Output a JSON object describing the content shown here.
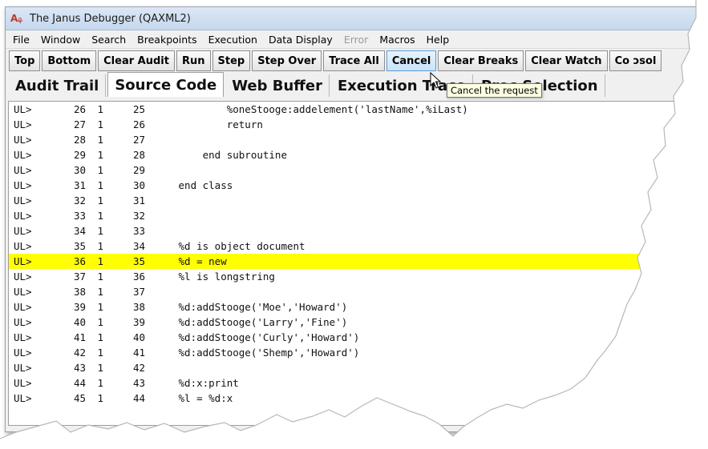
{
  "window": {
    "title": "The Janus Debugger (QAXML2)"
  },
  "menu": [
    {
      "label": "File",
      "disabled": false
    },
    {
      "label": "Window",
      "disabled": false
    },
    {
      "label": "Search",
      "disabled": false
    },
    {
      "label": "Breakpoints",
      "disabled": false
    },
    {
      "label": "Execution",
      "disabled": false
    },
    {
      "label": "Data Display",
      "disabled": false
    },
    {
      "label": "Error",
      "disabled": true
    },
    {
      "label": "Macros",
      "disabled": false
    },
    {
      "label": "Help",
      "disabled": false
    }
  ],
  "toolbar": [
    {
      "label": "Top",
      "active": false
    },
    {
      "label": "Bottom",
      "active": false
    },
    {
      "label": "Clear Audit",
      "active": false
    },
    {
      "label": "Run",
      "active": false
    },
    {
      "label": "Step",
      "active": false
    },
    {
      "label": "Step Over",
      "active": false
    },
    {
      "label": "Trace All",
      "active": false
    },
    {
      "label": "Cancel",
      "active": true
    },
    {
      "label": "Clear Breaks",
      "active": false
    },
    {
      "label": "Clear Watch",
      "active": false
    },
    {
      "label": "Co ɔsol",
      "active": false
    }
  ],
  "tabs": [
    {
      "label": "Audit Trail",
      "selected": false
    },
    {
      "label": "Source Code",
      "selected": true
    },
    {
      "label": "Web Buffer",
      "selected": false
    },
    {
      "label": "Execution Trace",
      "selected": false
    },
    {
      "label": "Proc Selection",
      "selected": false
    }
  ],
  "tooltip": "Cancel the request",
  "highlight_color": "#ffff00",
  "code_lines": [
    {
      "prefix": "UL>",
      "num": "26",
      "lvl": "1",
      "src": "25",
      "text": "         %oneStooge:addelement('lastName',%iLast)",
      "highlight": false
    },
    {
      "prefix": "UL>",
      "num": "27",
      "lvl": "1",
      "src": "26",
      "text": "         return",
      "highlight": false
    },
    {
      "prefix": "UL>",
      "num": "28",
      "lvl": "1",
      "src": "27",
      "text": "",
      "highlight": false
    },
    {
      "prefix": "UL>",
      "num": "29",
      "lvl": "1",
      "src": "28",
      "text": "     end subroutine",
      "highlight": false
    },
    {
      "prefix": "UL>",
      "num": "30",
      "lvl": "1",
      "src": "29",
      "text": "",
      "highlight": false
    },
    {
      "prefix": "UL>",
      "num": "31",
      "lvl": "1",
      "src": "30",
      "text": " end class",
      "highlight": false
    },
    {
      "prefix": "UL>",
      "num": "32",
      "lvl": "1",
      "src": "31",
      "text": "",
      "highlight": false
    },
    {
      "prefix": "UL>",
      "num": "33",
      "lvl": "1",
      "src": "32",
      "text": "",
      "highlight": false
    },
    {
      "prefix": "UL>",
      "num": "34",
      "lvl": "1",
      "src": "33",
      "text": "",
      "highlight": false
    },
    {
      "prefix": "UL>",
      "num": "35",
      "lvl": "1",
      "src": "34",
      "text": " %d is object document",
      "highlight": false
    },
    {
      "prefix": "UL>",
      "num": "36",
      "lvl": "1",
      "src": "35",
      "text": " %d = new",
      "highlight": true
    },
    {
      "prefix": "UL>",
      "num": "37",
      "lvl": "1",
      "src": "36",
      "text": " %l is longstring",
      "highlight": false
    },
    {
      "prefix": "UL>",
      "num": "38",
      "lvl": "1",
      "src": "37",
      "text": "",
      "highlight": false
    },
    {
      "prefix": "UL>",
      "num": "39",
      "lvl": "1",
      "src": "38",
      "text": " %d:addStooge('Moe','Howard')",
      "highlight": false
    },
    {
      "prefix": "UL>",
      "num": "40",
      "lvl": "1",
      "src": "39",
      "text": " %d:addStooge('Larry','Fine')",
      "highlight": false
    },
    {
      "prefix": "UL>",
      "num": "41",
      "lvl": "1",
      "src": "40",
      "text": " %d:addStooge('Curly','Howard')",
      "highlight": false
    },
    {
      "prefix": "UL>",
      "num": "42",
      "lvl": "1",
      "src": "41",
      "text": " %d:addStooge('Shemp','Howard')",
      "highlight": false
    },
    {
      "prefix": "UL>",
      "num": "43",
      "lvl": "1",
      "src": "42",
      "text": "",
      "highlight": false
    },
    {
      "prefix": "UL>",
      "num": "44",
      "lvl": "1",
      "src": "43",
      "text": " %d:x:print",
      "highlight": false
    },
    {
      "prefix": "UL>",
      "num": "45",
      "lvl": "1",
      "src": "44",
      "text": " %l = %d:x",
      "highlight": false
    }
  ]
}
